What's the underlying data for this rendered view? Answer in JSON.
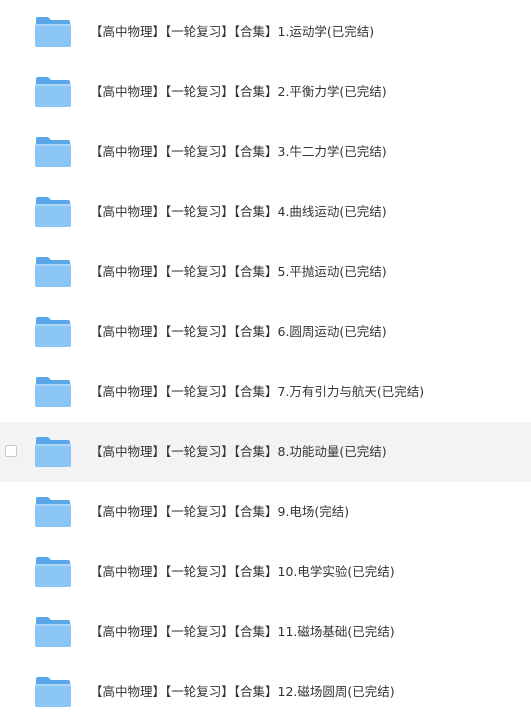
{
  "files": [
    {
      "name": "【高中物理】【一轮复习】【合集】1.运动学(已完结)",
      "icon": "folder-icon"
    },
    {
      "name": "【高中物理】【一轮复习】【合集】2.平衡力学(已完结)",
      "icon": "folder-icon"
    },
    {
      "name": "【高中物理】【一轮复习】【合集】3.牛二力学(已完结)",
      "icon": "folder-icon"
    },
    {
      "name": "【高中物理】【一轮复习】【合集】4.曲线运动(已完结)",
      "icon": "folder-icon"
    },
    {
      "name": "【高中物理】【一轮复习】【合集】5.平抛运动(已完结)",
      "icon": "folder-icon"
    },
    {
      "name": "【高中物理】【一轮复习】【合集】6.圆周运动(已完结)",
      "icon": "folder-icon"
    },
    {
      "name": "【高中物理】【一轮复习】【合集】7.万有引力与航天(已完结)",
      "icon": "folder-icon"
    },
    {
      "name": "【高中物理】【一轮复习】【合集】8.功能动量(已完结)",
      "icon": "folder-icon",
      "hovered": true
    },
    {
      "name": "【高中物理】【一轮复习】【合集】9.电场(完结)",
      "icon": "folder-icon"
    },
    {
      "name": "【高中物理】【一轮复习】【合集】10.电学实验(已完结)",
      "icon": "folder-icon"
    },
    {
      "name": "【高中物理】【一轮复习】【合集】11.磁场基础(已完结)",
      "icon": "folder-icon"
    },
    {
      "name": "【高中物理】【一轮复习】【合集】12.磁场圆周(已完结)",
      "icon": "folder-icon"
    }
  ],
  "colors": {
    "folder_back": "#5aa6e8",
    "folder_front": "#8cc6f4",
    "text": "#333333",
    "hover_bg": "#f3f3f3"
  }
}
